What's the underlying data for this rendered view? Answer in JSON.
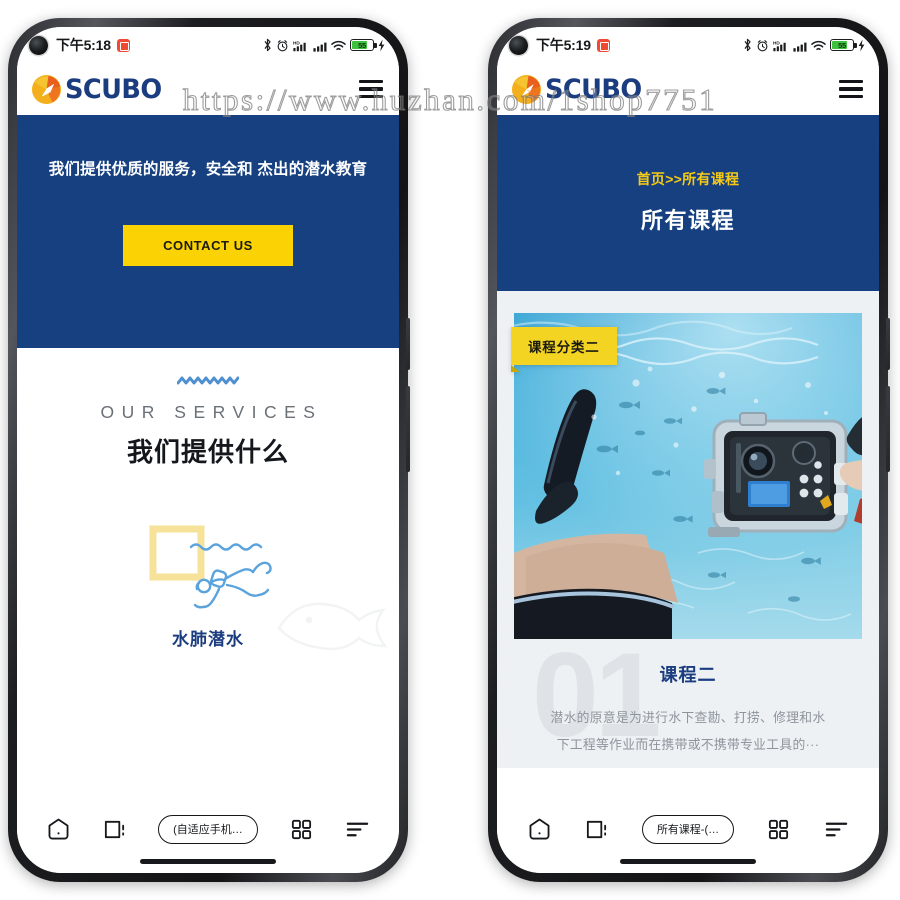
{
  "watermark": "https://www.huzhan.com/1shop7751",
  "phones": [
    {
      "id": "left",
      "status": {
        "time": "下午5:18",
        "battery_level": "55"
      },
      "header": {
        "brand": "SCUBO",
        "menu_icon": "hamburger-icon"
      },
      "hero": {
        "title": "我们提供优质的服务，安全和 杰出的潜水教育",
        "cta_label": "CONTACT US"
      },
      "services": {
        "eyebrow": "OUR SERVICES",
        "title": "我们提供什么",
        "items": [
          {
            "name": "水肺潜水",
            "icon": "scuba-diver-icon"
          }
        ]
      },
      "navbar": {
        "home_icon": "home-icon",
        "back_icon": "back-page-icon",
        "tab_label": "(自适应手机…",
        "apps_icon": "apps-grid-icon",
        "menu_icon": "menu-lines-icon"
      }
    },
    {
      "id": "right",
      "status": {
        "time": "下午5:19",
        "battery_level": "55"
      },
      "header": {
        "brand": "SCUBO",
        "menu_icon": "hamburger-icon"
      },
      "pagehead": {
        "breadcrumb": "首页>>所有课程",
        "title": "所有课程"
      },
      "course": {
        "category_badge": "课程分类二",
        "photo_alt": "underwater-diver-camera-photo",
        "ghost_number": "01",
        "name": "课程二",
        "description": "潜水的原意是为进行水下查勘、打捞、修理和水下工程等作业而在携带或不携带专业工具的···"
      },
      "navbar": {
        "home_icon": "home-icon",
        "back_icon": "back-page-icon",
        "tab_label": "所有课程-(…",
        "apps_icon": "apps-grid-icon",
        "menu_icon": "menu-lines-icon"
      }
    }
  ],
  "colors": {
    "brand_navy": "#164080",
    "brand_yellow": "#fbd304",
    "badge_yellow": "#f3d422",
    "breadcrumb_yellow": "#f6c914",
    "card_bg": "#eef1f4",
    "logo_text": "#1b3d80"
  }
}
